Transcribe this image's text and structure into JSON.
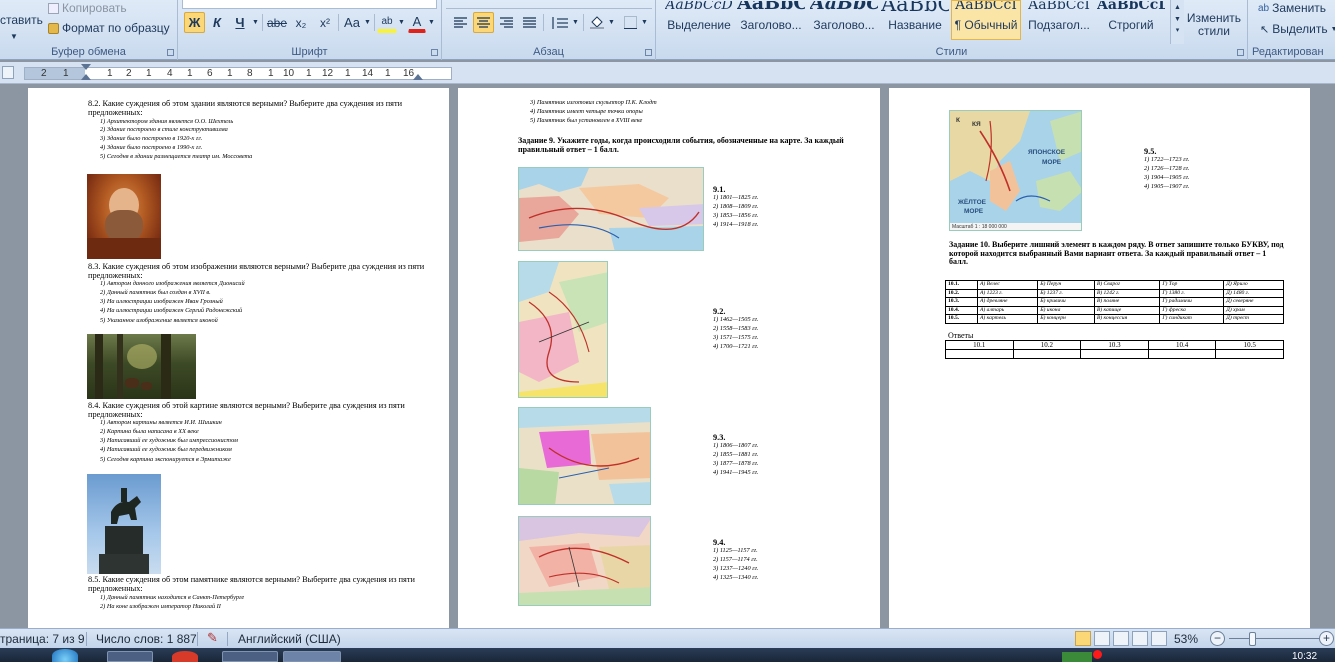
{
  "ribbon": {
    "clipboard": {
      "paste": "ставить",
      "copy": "Копировать",
      "format_painter": "Формат по образцу",
      "label": "Буфер обмена"
    },
    "font": {
      "bold": "Ж",
      "italic": "К",
      "underline": "Ч",
      "strike": "abe",
      "subscript": "x₂",
      "superscript": "x²",
      "case": "Aa",
      "highlight": "ab",
      "color": "A",
      "label": "Шрифт"
    },
    "paragraph": {
      "label": "Абзац"
    },
    "styles": {
      "label": "Стили",
      "items": [
        {
          "preview": "AaBbCcD",
          "name": "Выделение"
        },
        {
          "preview": "AaBbC",
          "name": "Заголово..."
        },
        {
          "preview": "AaBbC",
          "name": "Заголово..."
        },
        {
          "preview": "AaBbC",
          "name": "Название"
        },
        {
          "preview": "AaBbCcI",
          "name": "¶ Обычный"
        },
        {
          "preview": "AaBbCcI",
          "name": "Подзагол..."
        },
        {
          "preview": "AaBbCcD",
          "name": "Строгий"
        }
      ],
      "change_styles": "Изменить стили"
    },
    "editing": {
      "replace": "Заменить",
      "select": "Выделить",
      "label": "Редактирован"
    }
  },
  "ruler": {
    "numbers": [
      "2",
      "1",
      "1",
      "2",
      "1",
      "4",
      "1",
      "6",
      "1",
      "8",
      "1",
      "10",
      "1",
      "12",
      "1",
      "14",
      "1",
      "16"
    ]
  },
  "page1": {
    "q82": "8.2. Какие суждения об этом здании являются верными? Выберите два суждения из пяти предложенных:",
    "q82_opts": [
      "1) Архитектором здания является О.О. Шехтель",
      "2) Здание построено в стиле конструктивизма",
      "3) Здание было построено в 1920-х гг.",
      "4) Здание было построено в 1990-х гг.",
      "5) Сегодня в здании размещается театр им. Моссовета"
    ],
    "q83": "8.3. Какие суждения об этом изображении являются верными? Выберите два суждения из пяти предложенных:",
    "q83_opts": [
      "1) Автором данного изображения является Дионисий",
      "2) Данный памятник был создан в XVII в.",
      "3) На иллюстрации изображен Иван Грозный",
      "4) На иллюстрации изображен Сергий Радонежский",
      "5) Указанное изображение является иконой"
    ],
    "q84": "8.4. Какие суждения об этой картине являются верными? Выберите два суждения из пяти предложенных:",
    "q84_opts": [
      "1) Автором картины является И.И. Шишкин",
      "2) Картина была написана в XX веке",
      "3) Написавший ее художник был импрессионистом",
      "4) Написавший ее художник был передвижником",
      "5) Сегодня картина экспонируется в Эрмитаже"
    ],
    "q85": "8.5. Какие суждения об этом памятнике являются верными? Выберите два суждения из пяти предложенных:",
    "q85_opts": [
      "1) Данный памятник находится в Санкт-Петербурге",
      "2) На коне изображен император Николай II"
    ]
  },
  "page2": {
    "top_opts": [
      "3) Памятник изготовил скульптор П.К. Клодт",
      "4) Памятник имеет четыре точки опоры",
      "5) Памятник был установлен в XVIII веке"
    ],
    "task9": "Задание 9. Укажите годы, когда происходили события, обозначенные на карте. За каждый правильный ответ – 1 балл.",
    "blocks": [
      {
        "label": "9.1.",
        "opts": [
          "1) 1801—1825 гг.",
          "2) 1808—1809 гг.",
          "3) 1853—1856 гг.",
          "4) 1914—1918 гг."
        ]
      },
      {
        "label": "9.2.",
        "opts": [
          "1) 1462—1505 гг.",
          "2) 1558—1583 гг.",
          "3) 1571—1575 гг.",
          "4) 1700—1721 гг."
        ]
      },
      {
        "label": "9.3.",
        "opts": [
          "1) 1806—1807 гг.",
          "2) 1855—1881 гг.",
          "3) 1877—1878 гг.",
          "4) 1941—1945 гг."
        ]
      },
      {
        "label": "9.4.",
        "opts": [
          "1) 1125—1157 гг.",
          "2) 1157—1174 гг.",
          "3) 1237—1240 гг.",
          "4) 1325—1340 гг."
        ]
      }
    ]
  },
  "page3": {
    "q95": {
      "label": "9.5.",
      "opts": [
        "1) 1722—1723 гг.",
        "2) 1726—1728 гг.",
        "3) 1904—1905 гг.",
        "4) 1905—1907 гг."
      ]
    },
    "map_labels": {
      "sea1": "ЯПОНСКОЕ",
      "sea1b": "МОРЕ",
      "sea2": "ЖЁЛТОЕ",
      "sea2b": "МОРЕ",
      "scale": "Масштаб 1 : 18 000 000",
      "a": "К",
      "b": "КЯ"
    },
    "task10": "Задание 10. Выберите лишний элемент в каждом ряду. В ответ запишите только БУКВУ, под которой находится выбранный Вами вариант ответа. За каждый правильный ответ – 1 балл.",
    "rows": [
      {
        "num": "10.1.",
        "cells": [
          "А) Велес",
          "Б) Перун",
          "В) Сварог",
          "Г) Тор",
          "Д) Ярило"
        ]
      },
      {
        "num": "10.2.",
        "cells": [
          "А) 1223 г.",
          "Б) 1237 г.",
          "В) 1242 г.",
          "Г) 1380 г.",
          "Д) 1480 г."
        ]
      },
      {
        "num": "10.3.",
        "cells": [
          "А) древляне",
          "Б) кривичи",
          "В) поляне",
          "Г) радимичи",
          "Д) северяне"
        ]
      },
      {
        "num": "10.4.",
        "cells": [
          "А) алтарь",
          "Б) икона",
          "В) капище",
          "Г) фреска",
          "Д) храм"
        ]
      },
      {
        "num": "10.5.",
        "cells": [
          "А) картель",
          "Б) концерн",
          "В) концессия",
          "Г) синдикат",
          "Д) трест"
        ]
      }
    ],
    "answers_label": "Ответы",
    "answer_cols": [
      "10.1",
      "10.2",
      "10.3",
      "10.4",
      "10.5"
    ]
  },
  "status": {
    "page": "траница: 7 из 9",
    "words": "Число слов: 1 887",
    "lang": "Английский (США)",
    "zoom": "53%",
    "minus": "−",
    "plus": "+"
  },
  "taskbar": {
    "clock": "10:32"
  },
  "colors": {
    "accent": "#fbd778",
    "ribbon_bg": "#dfeaf7",
    "status_bg": "#c3d4ea"
  }
}
